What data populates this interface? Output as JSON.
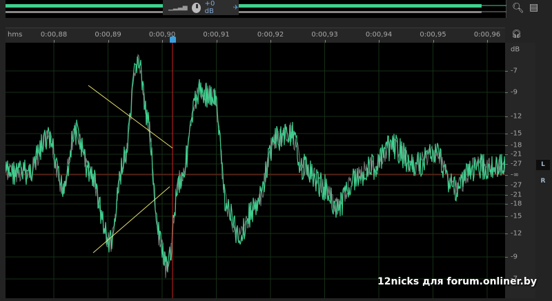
{
  "overview": {
    "gain_label": "+0 dB"
  },
  "ruler": {
    "unit": "hms",
    "ticks": [
      "0:00,88",
      "0:00,89",
      "0:00,90",
      "0:00,91",
      "0:00,92",
      "0:00,93",
      "0:00,94",
      "0:00,95",
      "0:00,96"
    ]
  },
  "scale": {
    "unit": "dB",
    "labels": [
      "-7",
      "-9",
      "-12",
      "-15",
      "-18",
      "-21",
      "-27",
      "-∞",
      "-27",
      "-21",
      "-18",
      "-15",
      "-12",
      "-9",
      "-7"
    ]
  },
  "channels": {
    "left": "L",
    "right": "R"
  },
  "watermark": "12nicks для forum.onliner.by",
  "colors": {
    "waveform": "#3fcf8e",
    "playhead": "#d02020",
    "background": "#000000"
  }
}
